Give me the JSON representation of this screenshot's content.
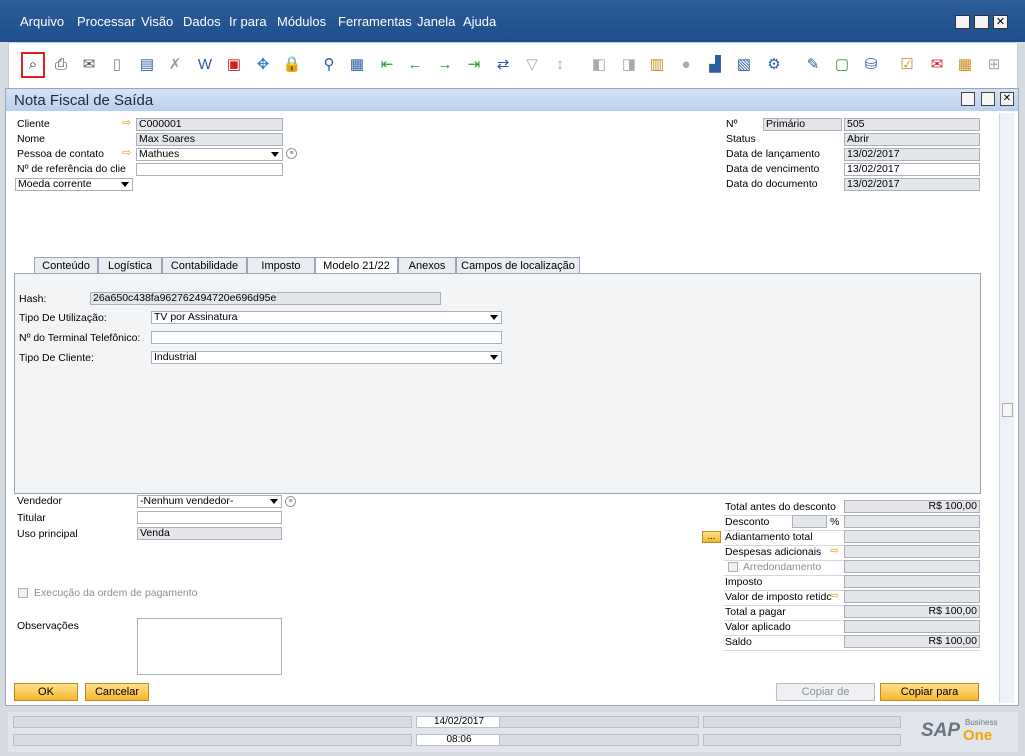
{
  "menu": [
    "Arquivo",
    "Processar",
    "Visão",
    "Dados",
    "Ir para",
    "Módulos",
    "Ferramentas",
    "Janela",
    "Ajuda"
  ],
  "window": {
    "title": "Nota Fiscal de Saída"
  },
  "header": {
    "cliente_label": "Cliente",
    "cliente": "C000001",
    "nome_label": "Nome",
    "nome": "Max Soares",
    "contato_label": "Pessoa de contato",
    "contato": "Mathues",
    "ref_label": "Nº de referência do clie",
    "ref": "",
    "moeda": "Moeda corrente",
    "no_label": "Nº",
    "serie": "Primário",
    "numero": "505",
    "status_label": "Status",
    "status": "Abrir",
    "lanc_label": "Data de lançamento",
    "lanc": "13/02/2017",
    "venc_label": "Data de vencimento",
    "venc": "13/02/2017",
    "doc_label": "Data do documento",
    "doc": "13/02/2017"
  },
  "tabs": [
    "Conteúdo",
    "Logística",
    "Contabilidade",
    "Imposto",
    "Modelo 21/22",
    "Anexos",
    "Campos de localização"
  ],
  "modelo": {
    "hash_label": "Hash:",
    "hash": "26a650c438fa962762494720e696d95e",
    "tipo_util_label": "Tipo De Utilização:",
    "tipo_util": "TV por Assinatura",
    "terminal_label": "Nº do Terminal Telefônico:",
    "terminal": "",
    "tipo_cli_label": "Tipo De Cliente:",
    "tipo_cli": "Industrial"
  },
  "footer": {
    "vendedor_label": "Vendedor",
    "vendedor": "-Nenhum vendedor-",
    "titular_label": "Titular",
    "titular": "",
    "uso_label": "Uso principal",
    "uso": "Venda",
    "execucao_label": "Execução da ordem de pagamento",
    "obs_label": "Observações"
  },
  "totals": {
    "antes_label": "Total antes do desconto",
    "antes": "R$ 100,00",
    "desconto_label": "Desconto",
    "percent": "%",
    "adiant_label": "Adiantamento total",
    "dots": "...",
    "despesas_label": "Despesas adicionais",
    "arred_label": "Arredondamento",
    "imposto_label": "Imposto",
    "retido_label": "Valor de imposto retidc",
    "pagar_label": "Total a pagar",
    "pagar": "R$ 100,00",
    "aplicado_label": "Valor aplicado",
    "saldo_label": "Saldo",
    "saldo": "R$ 100,00"
  },
  "buttons": {
    "ok": "OK",
    "cancelar": "Cancelar",
    "copiar_de": "Copiar de",
    "copiar_para": "Copiar para"
  },
  "statusbar": {
    "date": "14/02/2017",
    "time": "08:06",
    "brand": "SAP",
    "brand_sub": "Business",
    "brand_one": "One"
  }
}
